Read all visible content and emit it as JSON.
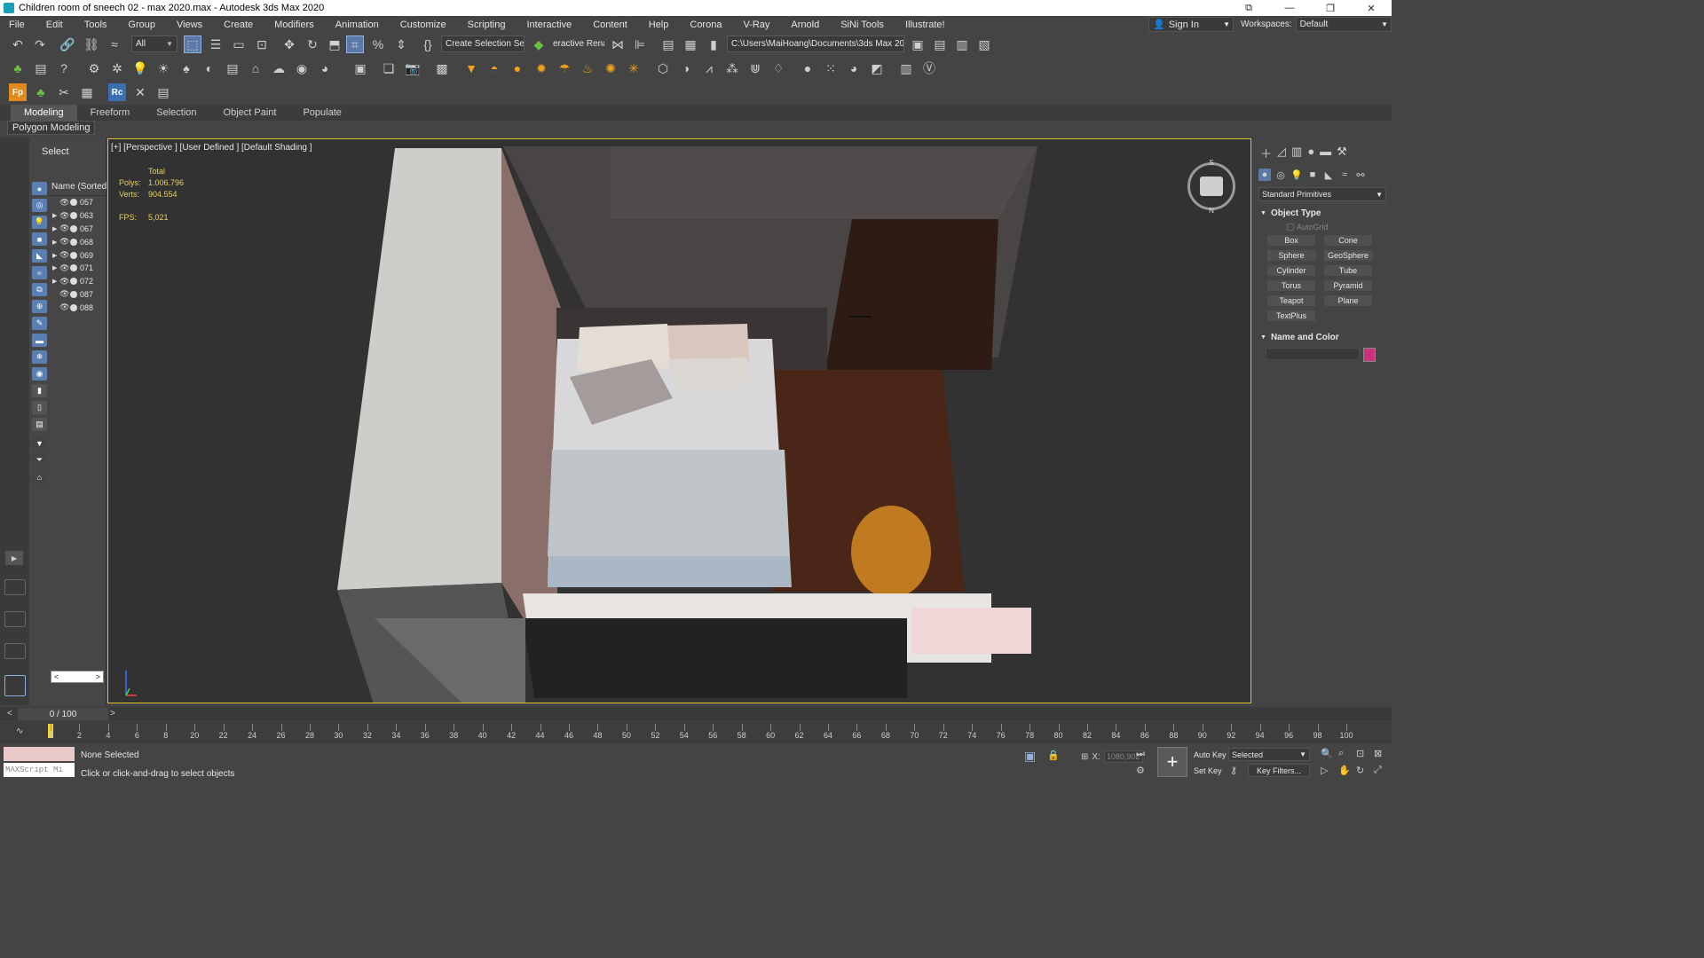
{
  "titlebar": {
    "title": "Children room of sneech 02 - max 2020.max - Autodesk 3ds Max 2020",
    "min": "—",
    "restore": "❐",
    "close": "✕"
  },
  "menu": [
    "File",
    "Edit",
    "Tools",
    "Group",
    "Views",
    "Create",
    "Modifiers",
    "Animation",
    "Customize",
    "Scripting",
    "Interactive",
    "Content",
    "Help",
    "Corona",
    "V-Ray",
    "Arnold",
    "SiNi Tools",
    "Illustrate!"
  ],
  "signin": {
    "label": "Sign In"
  },
  "workspaces": {
    "label": "Workspaces:",
    "value": "Default"
  },
  "toolbar": {
    "filter_value": "All",
    "selection_set": "Create Selection Se",
    "render_label": "eractive Rena",
    "path_value": "C:\\Users\\MaiHoang\\Documents\\3ds Max 2020"
  },
  "ribbon": {
    "tabs": [
      "Modeling",
      "Freeform",
      "Selection",
      "Object Paint",
      "Populate"
    ],
    "sub": "Polygon Modeling"
  },
  "scene_explorer": {
    "select_label": "Select",
    "column_header": "Name (Sorted A",
    "rows": [
      {
        "expand": false,
        "label": "057"
      },
      {
        "expand": true,
        "label": "063"
      },
      {
        "expand": true,
        "label": "067"
      },
      {
        "expand": true,
        "label": "068"
      },
      {
        "expand": true,
        "label": "069"
      },
      {
        "expand": true,
        "label": "071"
      },
      {
        "expand": true,
        "label": "072"
      },
      {
        "expand": false,
        "label": "087"
      },
      {
        "expand": false,
        "label": "088"
      }
    ]
  },
  "viewport": {
    "label": "[+] [Perspective ] [User Defined ] [Default Shading ]",
    "stats": {
      "total_label": "Total",
      "polys_label": "Polys:",
      "polys": "1.006.796",
      "verts_label": "Verts:",
      "verts": "904.554",
      "fps_label": "FPS:",
      "fps": "5,021"
    },
    "viewcube": {
      "north": "N",
      "south": "S"
    }
  },
  "command_panel": {
    "dropdown": "Standard Primitives",
    "object_type_title": "Object Type",
    "autogrid": "AutoGrid",
    "primitives": [
      "Box",
      "Cone",
      "Sphere",
      "GeoSphere",
      "Cylinder",
      "Tube",
      "Torus",
      "Pyramid",
      "Teapot",
      "Plane",
      "TextPlus"
    ],
    "name_color_title": "Name and Color",
    "color": "#d03080"
  },
  "timeslider": {
    "value": "0 / 100",
    "prev": "<",
    "next": ">"
  },
  "trackbar": {
    "ticks": [
      "0",
      "2",
      "4",
      "6",
      "8",
      "20",
      "22",
      "24",
      "26",
      "28",
      "30",
      "32",
      "34",
      "36",
      "38",
      "40",
      "42",
      "44",
      "46",
      "48",
      "50",
      "52",
      "54",
      "56",
      "58",
      "60",
      "62",
      "64",
      "66",
      "68",
      "70",
      "72",
      "74",
      "76",
      "78",
      "80",
      "82",
      "84",
      "86",
      "88",
      "90",
      "92",
      "94",
      "96",
      "98",
      "100"
    ]
  },
  "status": {
    "maxscript": "MAXScript Mi",
    "line1": "None Selected",
    "line2": "Click or click-and-drag to select objects",
    "x_label": "X:",
    "x_value": "1080,902",
    "auto_key": "Auto Key",
    "selected": "Selected",
    "set_key": "Set Key",
    "key_filters": "Key Filters..."
  }
}
